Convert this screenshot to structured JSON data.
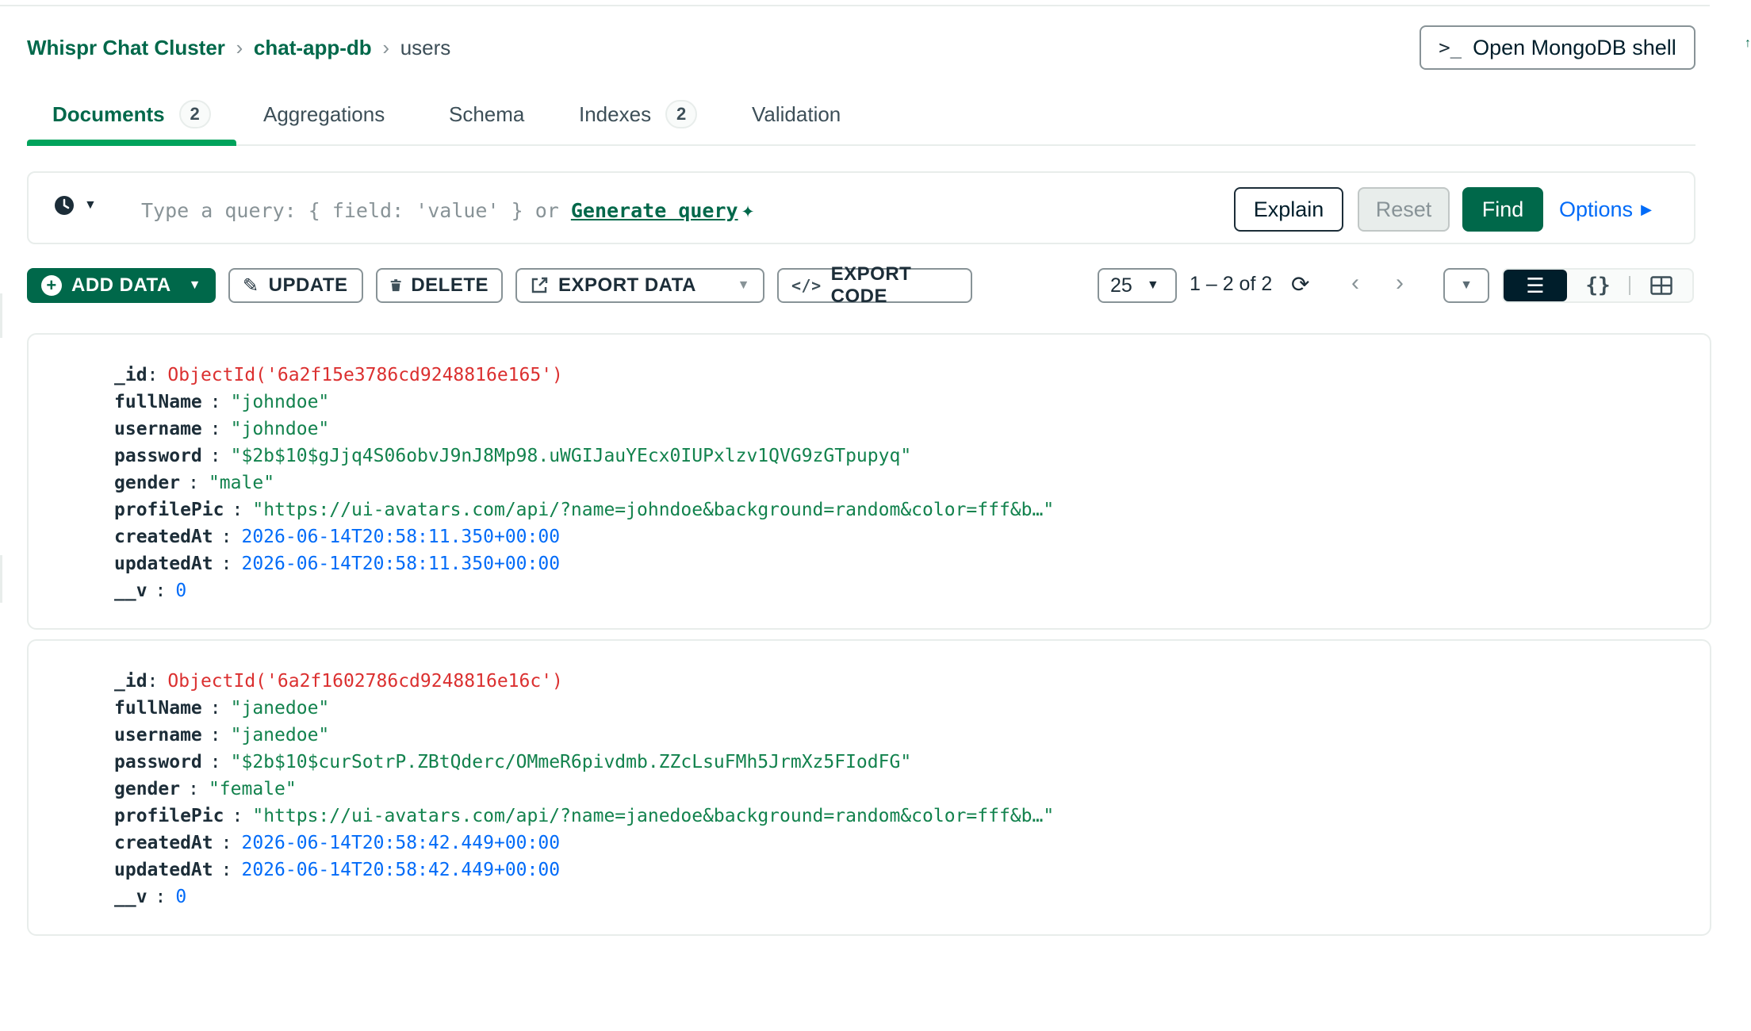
{
  "breadcrumb": {
    "cluster": "Whispr Chat Cluster",
    "database": "chat-app-db",
    "collection": "users"
  },
  "shell_button": {
    "label": "Open MongoDB shell",
    "icon": "terminal-icon"
  },
  "tabs": [
    {
      "label": "Documents",
      "count": "2",
      "active": true
    },
    {
      "label": "Aggregations"
    },
    {
      "label": "Schema"
    },
    {
      "label": "Indexes",
      "count": "2"
    },
    {
      "label": "Validation"
    }
  ],
  "query": {
    "placeholder_prefix": "Type a query: { field: 'value' } or",
    "generate_link": "Generate query",
    "explain": "Explain",
    "reset": "Reset",
    "find": "Find",
    "options": "Options"
  },
  "toolbar": {
    "add_data": "ADD DATA",
    "update": "UPDATE",
    "delete": "DELETE",
    "export_data": "EXPORT DATA",
    "export_code": "EXPORT CODE",
    "page_size": "25",
    "range": "1 – 2 of 2"
  },
  "documents": [
    {
      "_id": "ObjectId('6a2f15e3786cd9248816e165')",
      "fullName": "\"johndoe\"",
      "username": "\"johndoe\"",
      "password": "\"$2b$10$gJjq4S06obvJ9nJ8Mp98.uWGIJauYEcx0IUPxlzv1QVG9zGTpupyq\"",
      "gender": "\"male\"",
      "profilePic": "\"https://ui-avatars.com/api/?name=johndoe&background=random&color=fff&b…\"",
      "createdAt": "2026-06-14T20:58:11.350+00:00",
      "updatedAt": "2026-06-14T20:58:11.350+00:00",
      "__v": "0"
    },
    {
      "_id": "ObjectId('6a2f1602786cd9248816e16c')",
      "fullName": "\"janedoe\"",
      "username": "\"janedoe\"",
      "password": "\"$2b$10$curSotrP.ZBtQderc/OMmeR6pivdmb.ZZcLsuFMh5JrmXz5FIodFG\"",
      "gender": "\"female\"",
      "profilePic": "\"https://ui-avatars.com/api/?name=janedoe&background=random&color=fff&b…\"",
      "createdAt": "2026-06-14T20:58:42.449+00:00",
      "updatedAt": "2026-06-14T20:58:42.449+00:00",
      "__v": "0"
    }
  ],
  "field_keys": {
    "id": "_id",
    "fullName": "fullName",
    "username": "username",
    "password": "password",
    "gender": "gender",
    "profilePic": "profilePic",
    "createdAt": "createdAt",
    "updatedAt": "updatedAt",
    "v": "__v"
  },
  "colors": {
    "brand_green": "#00684a",
    "accent_green": "#00a35c",
    "link_blue": "#016bf8",
    "objectid_red": "#db3030",
    "string_green": "#12824d"
  }
}
